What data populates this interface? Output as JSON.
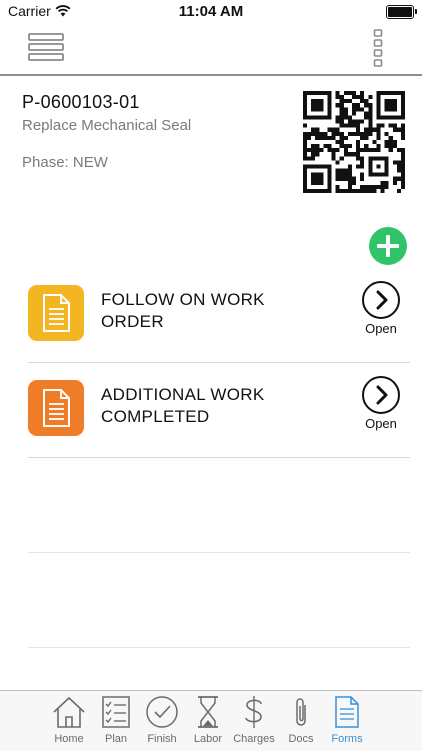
{
  "status_bar": {
    "carrier": "Carrier",
    "time": "11:04 AM"
  },
  "work_order": {
    "number": "P-0600103-01",
    "description": "Replace Mechanical Seal",
    "phase": "Phase: NEW"
  },
  "forms": [
    {
      "title": "FOLLOW ON WORK ORDER",
      "icon_color": "#f3b521",
      "action_label": "Open"
    },
    {
      "title": "ADDITIONAL WORK COMPLETED",
      "icon_color": "#f07c28",
      "action_label": "Open"
    }
  ],
  "tabs": [
    {
      "label": "Home",
      "icon": "home-icon"
    },
    {
      "label": "Plan",
      "icon": "checklist-icon"
    },
    {
      "label": "Finish",
      "icon": "checkmark-circle-icon"
    },
    {
      "label": "Labor",
      "icon": "hourglass-icon"
    },
    {
      "label": "Charges",
      "icon": "dollar-icon"
    },
    {
      "label": "Docs",
      "icon": "paperclip-icon"
    },
    {
      "label": "Forms",
      "icon": "document-icon",
      "active": true
    }
  ],
  "colors": {
    "accent": "#3a8fd6",
    "add_button": "#2fc36a",
    "form_yellow": "#f3b521",
    "form_orange": "#f07c28"
  }
}
